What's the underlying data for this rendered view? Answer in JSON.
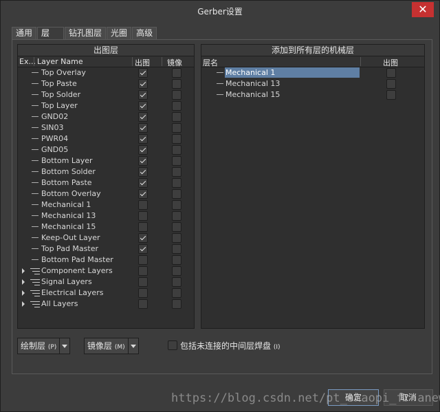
{
  "window": {
    "title": "Gerber设置",
    "close_label": "✕"
  },
  "tabs": [
    "通用",
    "层",
    "钻孔图层",
    "光圈",
    "高级"
  ],
  "left_panel": {
    "title": "出图层",
    "columns": {
      "ex": "Ex...",
      "layer": "Layer Name",
      "plot": "出图",
      "mirror": "镜像"
    },
    "rows": [
      {
        "name": "Top Overlay",
        "plot": true,
        "mirror": false,
        "group": false
      },
      {
        "name": "Top Paste",
        "plot": true,
        "mirror": false,
        "group": false
      },
      {
        "name": "Top Solder",
        "plot": true,
        "mirror": false,
        "group": false
      },
      {
        "name": "Top Layer",
        "plot": true,
        "mirror": false,
        "group": false
      },
      {
        "name": "GND02",
        "plot": true,
        "mirror": false,
        "group": false
      },
      {
        "name": "SIN03",
        "plot": true,
        "mirror": false,
        "group": false
      },
      {
        "name": "PWR04",
        "plot": true,
        "mirror": false,
        "group": false
      },
      {
        "name": "GND05",
        "plot": true,
        "mirror": false,
        "group": false
      },
      {
        "name": "Bottom Layer",
        "plot": true,
        "mirror": false,
        "group": false
      },
      {
        "name": "Bottom Solder",
        "plot": true,
        "mirror": false,
        "group": false
      },
      {
        "name": "Bottom Paste",
        "plot": true,
        "mirror": false,
        "group": false
      },
      {
        "name": "Bottom Overlay",
        "plot": true,
        "mirror": false,
        "group": false
      },
      {
        "name": "Mechanical 1",
        "plot": false,
        "mirror": false,
        "group": false
      },
      {
        "name": "Mechanical 13",
        "plot": false,
        "mirror": false,
        "group": false
      },
      {
        "name": "Mechanical 15",
        "plot": false,
        "mirror": false,
        "group": false
      },
      {
        "name": "Keep-Out Layer",
        "plot": true,
        "mirror": false,
        "group": false
      },
      {
        "name": "Top Pad Master",
        "plot": true,
        "mirror": false,
        "group": false
      },
      {
        "name": "Bottom Pad Master",
        "plot": false,
        "mirror": false,
        "group": false
      },
      {
        "name": "Component Layers",
        "plot": false,
        "mirror": false,
        "group": true
      },
      {
        "name": "Signal Layers",
        "plot": false,
        "mirror": false,
        "group": true
      },
      {
        "name": "Electrical Layers",
        "plot": false,
        "mirror": false,
        "group": true
      },
      {
        "name": "All Layers",
        "plot": false,
        "mirror": false,
        "group": true
      }
    ]
  },
  "right_panel": {
    "title": "添加到所有层的机械层",
    "columns": {
      "layer": "层名",
      "plot": "出图"
    },
    "rows": [
      {
        "name": "Mechanical 1",
        "plot": false,
        "selected": true
      },
      {
        "name": "Mechanical 13",
        "plot": false,
        "selected": false
      },
      {
        "name": "Mechanical 15",
        "plot": false,
        "selected": false
      }
    ]
  },
  "controls": {
    "plot_layers_btn": "绘制层",
    "plot_layers_key": "(P)",
    "mirror_layers_btn": "镜像层",
    "mirror_layers_key": "(M)",
    "include_unconnected": "包括未连接的中间层焊盘",
    "include_unconnected_key": "(I)",
    "include_checked": false
  },
  "footer": {
    "ok_label": "确定",
    "cancel_label": "取消",
    "watermark": "https://blog.csdn.net/pt_shaopi_fr anew_"
  }
}
